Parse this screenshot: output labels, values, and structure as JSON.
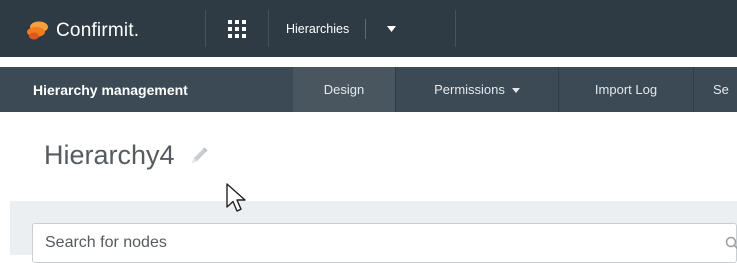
{
  "header": {
    "logo_text": "Confirmit.",
    "apps_icon": "grid-icon",
    "app_switcher_label": "Hierarchies",
    "app_switcher_caret": "caret-down-icon"
  },
  "nav": {
    "brand": "Hierarchy management",
    "tabs": [
      {
        "label": "Design"
      },
      {
        "label": "Permissions",
        "icon": "caret-down-icon"
      },
      {
        "label": "Import Log"
      },
      {
        "label": "Se"
      }
    ]
  },
  "page": {
    "title": "Hierarchy4",
    "edit_icon": "pencil-icon"
  },
  "search": {
    "placeholder": "Search for nodes",
    "icon": "search-icon"
  },
  "colors": {
    "topbar": "#2e3a44",
    "navbar": "#3c4a55",
    "logo_orange": "#f47b20",
    "title_text": "#555b60"
  }
}
